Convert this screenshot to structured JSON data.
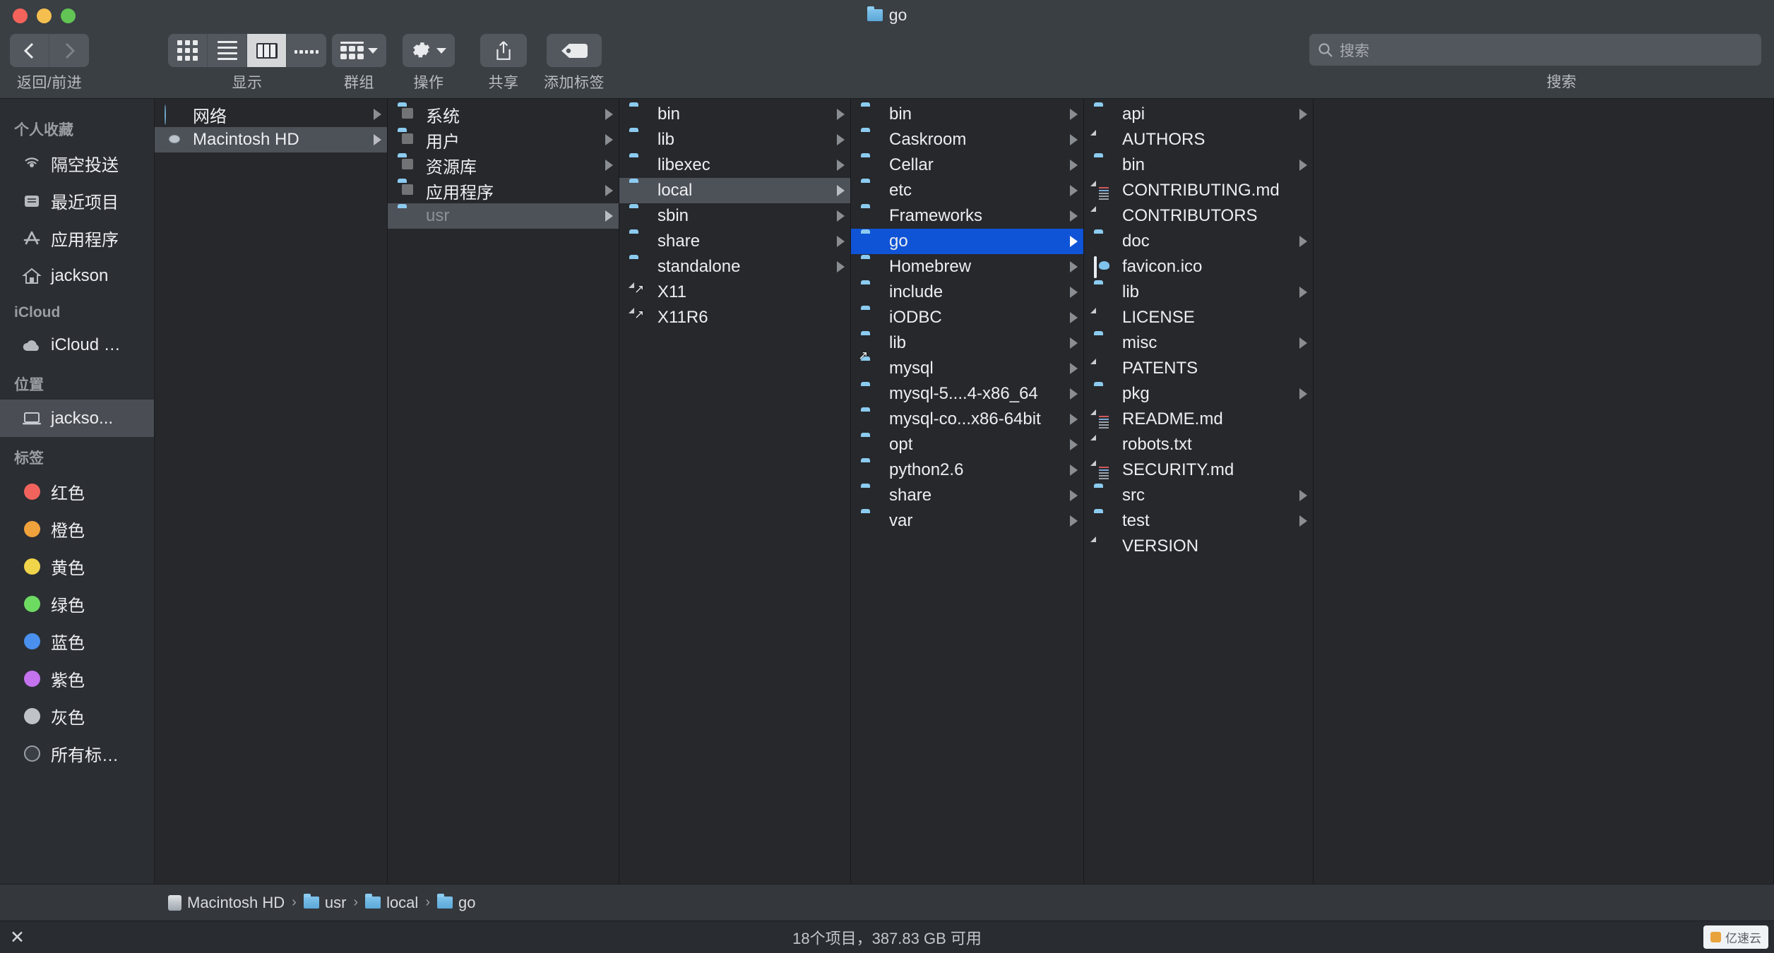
{
  "window": {
    "title": "go",
    "title_icon": "folder-icon"
  },
  "toolbar": {
    "nav_label": "返回/前进",
    "back_icon": "chevron-left-icon",
    "forward_icon": "chevron-right-icon",
    "view_label": "显示",
    "view_modes": [
      {
        "name": "icon-view",
        "icon": "grid-icon",
        "active": false
      },
      {
        "name": "list-view",
        "icon": "list-icon",
        "active": false
      },
      {
        "name": "column-view",
        "icon": "columns-icon",
        "active": true
      },
      {
        "name": "gallery-view",
        "icon": "gallery-icon",
        "active": false
      }
    ],
    "group_label": "群组",
    "group_icon": "group-icon",
    "action_label": "操作",
    "action_icon": "gear-icon",
    "share_label": "共享",
    "share_icon": "share-icon",
    "tag_label": "添加标签",
    "tag_icon": "tag-icon",
    "dropdown_icon": "chevron-down-icon"
  },
  "search": {
    "placeholder": "搜索",
    "value": "",
    "icon": "search-icon",
    "caption": "搜索"
  },
  "sidebar": {
    "sections": [
      {
        "header": "个人收藏",
        "items": [
          {
            "label": "隔空投送",
            "icon": "airdrop-icon",
            "selected": false
          },
          {
            "label": "最近项目",
            "icon": "recents-icon",
            "selected": false
          },
          {
            "label": "应用程序",
            "icon": "applications-icon",
            "selected": false
          },
          {
            "label": "jackson",
            "icon": "home-icon",
            "selected": false
          }
        ]
      },
      {
        "header": "iCloud",
        "items": [
          {
            "label": "iCloud …",
            "icon": "icloud-icon",
            "selected": false
          }
        ]
      },
      {
        "header": "位置",
        "items": [
          {
            "label": "jackso...",
            "icon": "laptop-icon",
            "selected": true
          }
        ]
      },
      {
        "header": "标签",
        "items": [
          {
            "label": "红色",
            "icon": "tag-dot-icon",
            "color": "#f2635d",
            "selected": false
          },
          {
            "label": "橙色",
            "icon": "tag-dot-icon",
            "color": "#f0a23c",
            "selected": false
          },
          {
            "label": "黄色",
            "icon": "tag-dot-icon",
            "color": "#f0d44a",
            "selected": false
          },
          {
            "label": "绿色",
            "icon": "tag-dot-icon",
            "color": "#6ddb61",
            "selected": false
          },
          {
            "label": "蓝色",
            "icon": "tag-dot-icon",
            "color": "#4a90ef",
            "selected": false
          },
          {
            "label": "紫色",
            "icon": "tag-dot-icon",
            "color": "#c472ee",
            "selected": false
          },
          {
            "label": "灰色",
            "icon": "tag-dot-icon",
            "color": "#bfc3c7",
            "selected": false
          },
          {
            "label": "所有标…",
            "icon": "all-tags-icon",
            "color": "#3a3f45",
            "selected": false
          }
        ]
      }
    ]
  },
  "columns": [
    {
      "name": "column-devices",
      "rows": [
        {
          "label": "网络",
          "kind": "globe",
          "arrow": true,
          "state": "normal"
        },
        {
          "label": "Macintosh HD",
          "kind": "disk",
          "arrow": true,
          "state": "sel-gray"
        }
      ]
    },
    {
      "name": "column-root",
      "rows": [
        {
          "label": "系统",
          "kind": "folder-tinted",
          "arrow": true,
          "state": "normal"
        },
        {
          "label": "用户",
          "kind": "folder-tinted",
          "arrow": true,
          "state": "normal"
        },
        {
          "label": "资源库",
          "kind": "folder-tinted",
          "arrow": true,
          "state": "normal"
        },
        {
          "label": "应用程序",
          "kind": "folder-tinted",
          "arrow": true,
          "state": "normal"
        },
        {
          "label": "usr",
          "kind": "folder",
          "arrow": true,
          "state": "sel-gray-dim"
        }
      ]
    },
    {
      "name": "column-usr",
      "rows": [
        {
          "label": "bin",
          "kind": "folder",
          "arrow": true,
          "state": "normal"
        },
        {
          "label": "lib",
          "kind": "folder",
          "arrow": true,
          "state": "normal"
        },
        {
          "label": "libexec",
          "kind": "folder",
          "arrow": true,
          "state": "normal"
        },
        {
          "label": "local",
          "kind": "folder",
          "arrow": true,
          "state": "sel-gray"
        },
        {
          "label": "sbin",
          "kind": "folder",
          "arrow": true,
          "state": "normal"
        },
        {
          "label": "share",
          "kind": "folder",
          "arrow": true,
          "state": "normal"
        },
        {
          "label": "standalone",
          "kind": "folder",
          "arrow": true,
          "state": "normal"
        },
        {
          "label": "X11",
          "kind": "file-alias",
          "arrow": false,
          "state": "normal"
        },
        {
          "label": "X11R6",
          "kind": "file-alias",
          "arrow": false,
          "state": "normal"
        }
      ]
    },
    {
      "name": "column-local",
      "rows": [
        {
          "label": "bin",
          "kind": "folder",
          "arrow": true,
          "state": "normal"
        },
        {
          "label": "Caskroom",
          "kind": "folder",
          "arrow": true,
          "state": "normal"
        },
        {
          "label": "Cellar",
          "kind": "folder",
          "arrow": true,
          "state": "normal"
        },
        {
          "label": "etc",
          "kind": "folder",
          "arrow": true,
          "state": "normal"
        },
        {
          "label": "Frameworks",
          "kind": "folder",
          "arrow": true,
          "state": "normal"
        },
        {
          "label": "go",
          "kind": "folder",
          "arrow": true,
          "state": "sel-blue"
        },
        {
          "label": "Homebrew",
          "kind": "folder",
          "arrow": true,
          "state": "normal"
        },
        {
          "label": "include",
          "kind": "folder",
          "arrow": true,
          "state": "normal"
        },
        {
          "label": "iODBC",
          "kind": "folder",
          "arrow": true,
          "state": "normal"
        },
        {
          "label": "lib",
          "kind": "folder",
          "arrow": true,
          "state": "normal"
        },
        {
          "label": "mysql",
          "kind": "folder-alias",
          "arrow": true,
          "state": "normal"
        },
        {
          "label": "mysql-5....4-x86_64",
          "kind": "folder",
          "arrow": true,
          "state": "normal"
        },
        {
          "label": "mysql-co...x86-64bit",
          "kind": "folder",
          "arrow": true,
          "state": "normal"
        },
        {
          "label": "opt",
          "kind": "folder",
          "arrow": true,
          "state": "normal"
        },
        {
          "label": "python2.6",
          "kind": "folder",
          "arrow": true,
          "state": "normal"
        },
        {
          "label": "share",
          "kind": "folder",
          "arrow": true,
          "state": "normal"
        },
        {
          "label": "var",
          "kind": "folder",
          "arrow": true,
          "state": "normal"
        }
      ]
    },
    {
      "name": "column-go",
      "rows": [
        {
          "label": "api",
          "kind": "folder",
          "arrow": true,
          "state": "normal"
        },
        {
          "label": "AUTHORS",
          "kind": "file",
          "arrow": false,
          "state": "normal"
        },
        {
          "label": "bin",
          "kind": "folder",
          "arrow": true,
          "state": "normal"
        },
        {
          "label": "CONTRIBUTING.md",
          "kind": "file-md",
          "arrow": false,
          "state": "normal"
        },
        {
          "label": "CONTRIBUTORS",
          "kind": "file",
          "arrow": false,
          "state": "normal"
        },
        {
          "label": "doc",
          "kind": "folder",
          "arrow": true,
          "state": "normal"
        },
        {
          "label": "favicon.ico",
          "kind": "image",
          "arrow": false,
          "state": "normal"
        },
        {
          "label": "lib",
          "kind": "folder",
          "arrow": true,
          "state": "normal"
        },
        {
          "label": "LICENSE",
          "kind": "file",
          "arrow": false,
          "state": "normal"
        },
        {
          "label": "misc",
          "kind": "folder",
          "arrow": true,
          "state": "normal"
        },
        {
          "label": "PATENTS",
          "kind": "file",
          "arrow": false,
          "state": "normal"
        },
        {
          "label": "pkg",
          "kind": "folder",
          "arrow": true,
          "state": "normal"
        },
        {
          "label": "README.md",
          "kind": "file-md",
          "arrow": false,
          "state": "normal"
        },
        {
          "label": "robots.txt",
          "kind": "file",
          "arrow": false,
          "state": "normal"
        },
        {
          "label": "SECURITY.md",
          "kind": "file-md",
          "arrow": false,
          "state": "normal"
        },
        {
          "label": "src",
          "kind": "folder",
          "arrow": true,
          "state": "normal"
        },
        {
          "label": "test",
          "kind": "folder",
          "arrow": true,
          "state": "normal"
        },
        {
          "label": "VERSION",
          "kind": "file",
          "arrow": false,
          "state": "normal"
        }
      ]
    }
  ],
  "pathbar": {
    "crumbs": [
      {
        "label": "Macintosh HD",
        "icon": "disk-icon"
      },
      {
        "label": "usr",
        "icon": "folder-icon"
      },
      {
        "label": "local",
        "icon": "folder-icon"
      },
      {
        "label": "go",
        "icon": "folder-icon"
      }
    ],
    "separator": "›"
  },
  "statusbar": {
    "text": "18个项目，387.83 GB 可用",
    "close_icon": "close-x-icon"
  },
  "watermark": {
    "text": "亿速云"
  },
  "colors": {
    "selection_blue": "#0f53d6",
    "selection_gray": "#4d5158",
    "window_chrome": "#3a3f44",
    "column_bg": "#26282c",
    "sidebar_bg": "#2b2e33"
  }
}
